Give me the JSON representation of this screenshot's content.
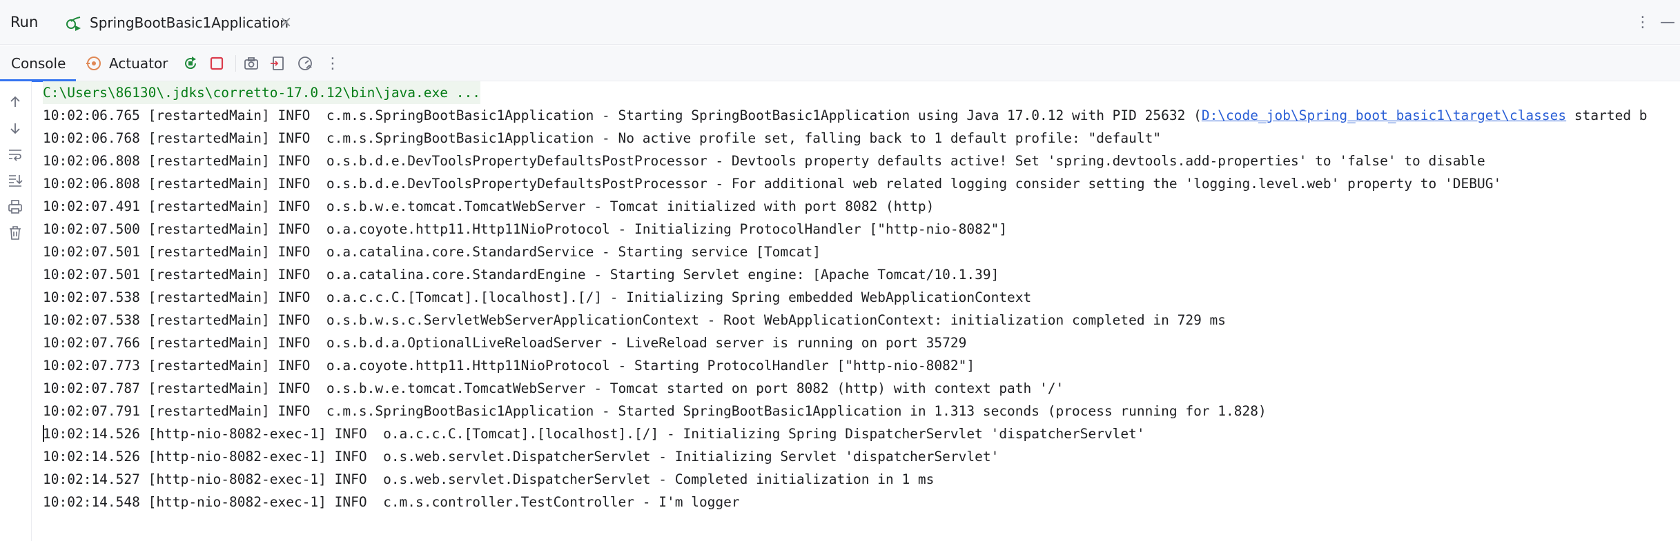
{
  "window": {
    "run_title": "Run",
    "tab_label": "SpringBootBasic1Application",
    "tab_close": "×",
    "more_icon": "⋮",
    "minimize_icon": "—"
  },
  "console_toolbar": {
    "console_tab": "Console",
    "actuator_tab": "Actuator",
    "more_icon": "⋮"
  },
  "console": {
    "command_line": "C:\\Users\\86130\\.jdks\\corretto-17.0.12\\bin\\java.exe ...",
    "first_line_prefix": "10:02:06.765 [restartedMain] INFO  c.m.s.SpringBootBasic1Application - Starting SpringBootBasic1Application using Java 17.0.12 with PID 25632 (",
    "first_line_link": "D:\\code_job\\Spring_boot_basic1\\target\\classes",
    "first_line_suffix": " started b",
    "lines": [
      "10:02:06.768 [restartedMain] INFO  c.m.s.SpringBootBasic1Application - No active profile set, falling back to 1 default profile: \"default\"",
      "10:02:06.808 [restartedMain] INFO  o.s.b.d.e.DevToolsPropertyDefaultsPostProcessor - Devtools property defaults active! Set 'spring.devtools.add-properties' to 'false' to disable",
      "10:02:06.808 [restartedMain] INFO  o.s.b.d.e.DevToolsPropertyDefaultsPostProcessor - For additional web related logging consider setting the 'logging.level.web' property to 'DEBUG'",
      "10:02:07.491 [restartedMain] INFO  o.s.b.w.e.tomcat.TomcatWebServer - Tomcat initialized with port 8082 (http)",
      "10:02:07.500 [restartedMain] INFO  o.a.coyote.http11.Http11NioProtocol - Initializing ProtocolHandler [\"http-nio-8082\"]",
      "10:02:07.501 [restartedMain] INFO  o.a.catalina.core.StandardService - Starting service [Tomcat]",
      "10:02:07.501 [restartedMain] INFO  o.a.catalina.core.StandardEngine - Starting Servlet engine: [Apache Tomcat/10.1.39]",
      "10:02:07.538 [restartedMain] INFO  o.a.c.c.C.[Tomcat].[localhost].[/] - Initializing Spring embedded WebApplicationContext",
      "10:02:07.538 [restartedMain] INFO  o.s.b.w.s.c.ServletWebServerApplicationContext - Root WebApplicationContext: initialization completed in 729 ms",
      "10:02:07.766 [restartedMain] INFO  o.s.b.d.a.OptionalLiveReloadServer - LiveReload server is running on port 35729",
      "10:02:07.773 [restartedMain] INFO  o.a.coyote.http11.Http11NioProtocol - Starting ProtocolHandler [\"http-nio-8082\"]",
      "10:02:07.787 [restartedMain] INFO  o.s.b.w.e.tomcat.TomcatWebServer - Tomcat started on port 8082 (http) with context path '/'",
      "10:02:07.791 [restartedMain] INFO  c.m.s.SpringBootBasic1Application - Started SpringBootBasic1Application in 1.313 seconds (process running for 1.828)",
      "10:02:14.526 [http-nio-8082-exec-1] INFO  o.a.c.c.C.[Tomcat].[localhost].[/] - Initializing Spring DispatcherServlet 'dispatcherServlet'",
      "10:02:14.526 [http-nio-8082-exec-1] INFO  o.s.web.servlet.DispatcherServlet - Initializing Servlet 'dispatcherServlet'",
      "10:02:14.527 [http-nio-8082-exec-1] INFO  o.s.web.servlet.DispatcherServlet - Completed initialization in 1 ms",
      "10:02:14.548 [http-nio-8082-exec-1] INFO  c.m.s.controller.TestController - I'm logger"
    ]
  },
  "colors": {
    "accent": "#3574f0",
    "stop_red": "#db3b4b",
    "rerun_green": "#208a3c",
    "actuator_orange": "#e08855",
    "command_green": "#067d17",
    "link_blue": "#2a5fd6"
  }
}
